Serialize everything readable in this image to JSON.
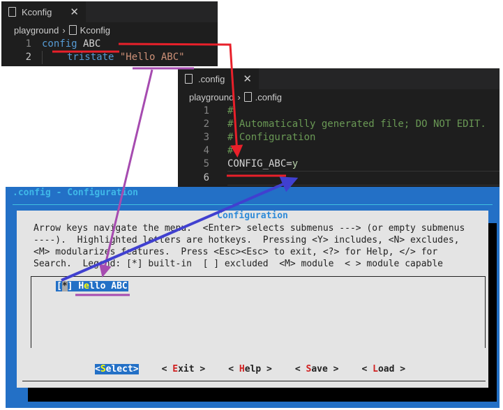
{
  "kconfig_editor": {
    "tab": "Kconfig",
    "breadcrumb": [
      "playground",
      "Kconfig"
    ],
    "lines": [
      {
        "n": "1",
        "kw": "config",
        "rest": " ABC"
      },
      {
        "n": "2",
        "kw": "tristate",
        "str": "\"Hello ABC\""
      }
    ]
  },
  "config_editor": {
    "tab": ".config",
    "breadcrumb": [
      "playground",
      ".config"
    ],
    "lines": [
      {
        "n": "1",
        "text": "#"
      },
      {
        "n": "2",
        "text": "# Automatically generated file; DO NOT EDIT."
      },
      {
        "n": "3",
        "text": "# Configuration"
      },
      {
        "n": "4",
        "text": "#"
      },
      {
        "n": "5",
        "key": "CONFIG_ABC=",
        "val": "y"
      },
      {
        "n": "6",
        "text": ""
      }
    ]
  },
  "menuconfig": {
    "window_title": ".config - Configuration",
    "dialog_title": "Configuration",
    "help": "Arrow keys navigate the menu.  <Enter> selects submenus ---> (or empty submenus\n----).  Highlighted letters are hotkeys.  Pressing <Y> includes, <N> excludes,\n<M> modularizes features.  Press <Esc><Esc> to exit, <?> for Help, </> for\nSearch.  Legend: [*] built-in  [ ] excluded  <M> module  < > module capable",
    "item": {
      "open": "[",
      "state": "*",
      "close": "] ",
      "pre": "H",
      "hotkey": "e",
      "post": "llo ABC"
    },
    "buttons": [
      {
        "l": "<",
        "h": "S",
        "r": "elect>"
      },
      {
        "l": "< ",
        "h": "E",
        "r": "xit >"
      },
      {
        "l": "< ",
        "h": "H",
        "r": "elp >"
      },
      {
        "l": "< ",
        "h": "S",
        "r": "ave >"
      },
      {
        "l": "< ",
        "h": "L",
        "r": "oad >"
      }
    ]
  },
  "colors": {
    "background": "#2370c6",
    "annotation_red": "#e8202a",
    "annotation_purple": "#a64bb0",
    "annotation_blue": "#4040d0"
  }
}
